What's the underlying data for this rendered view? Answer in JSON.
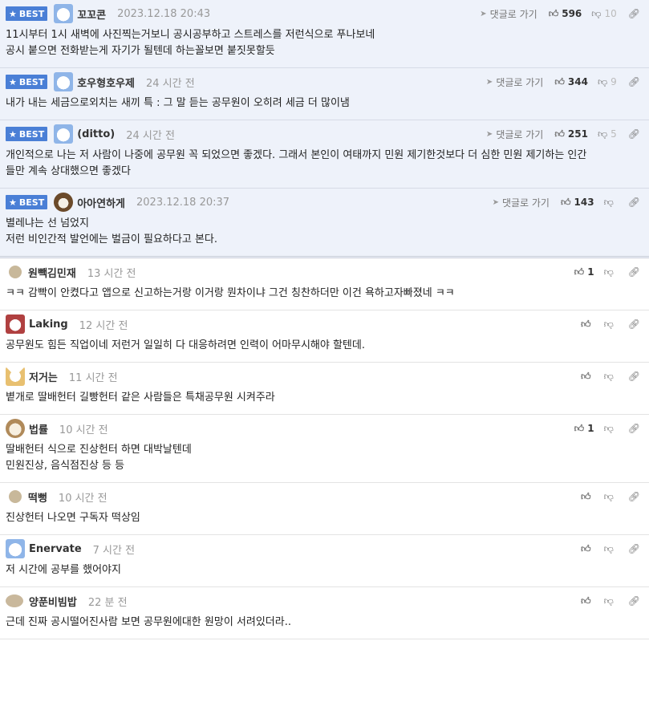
{
  "labels": {
    "best": "BEST",
    "reply": "댓글로 가기"
  },
  "comments": [
    {
      "best": true,
      "avatar": "avatar-blue-face-icon",
      "nick": "꼬꼬콘",
      "time": "2023.12.18 20:43",
      "reply": true,
      "likes": "596",
      "dislikes": "10",
      "lines": [
        "11시부터 1시 새벽에 사진찍는거보니 공시공부하고 스트레스를 저런식으로 푸나보네",
        "공시 붙으면 전화받는게 자기가 될텐데 하는꼴보면 붙짓못할듯"
      ]
    },
    {
      "best": true,
      "avatar": "avatar-blue-face-icon",
      "nick": "호우형호우제",
      "time": "24 시간 전",
      "reply": true,
      "likes": "344",
      "dislikes": "9",
      "lines": [
        "내가 내는 세금으로외치는 새끼 특 : 그 말 듣는 공무원이 오히려 세금 더 많이냄"
      ]
    },
    {
      "best": true,
      "avatar": "avatar-blue-face-icon",
      "nick": "(ditto)",
      "time": "24 시간 전",
      "reply": true,
      "likes": "251",
      "dislikes": "5",
      "lines": [
        "개인적으로 나는 저 사람이 나중에 공무원 꼭 되었으면 좋겠다. 그래서 본인이 여태까지 민원 제기한것보다 더 심한 민원 제기하는 인간",
        "들만 계속 상대했으면 좋겠다"
      ]
    },
    {
      "best": true,
      "avatar": "avatar-bear-icon",
      "nick": "아아연하게",
      "time": "2023.12.18 20:37",
      "reply": true,
      "likes": "143",
      "dislikes": "",
      "lines": [
        "별레냐는 선 넘었지",
        "저런 비인간적 발언에는 벌금이 필요하다고 본다."
      ]
    },
    {
      "best": false,
      "avatar": "avatar-dot-icon",
      "nick": "원빽김민재",
      "time": "13 시간 전",
      "reply": false,
      "likes": "1",
      "dislikes": "",
      "lines": [
        "ㅋㅋ 감빡이 안켰다고 앱으로 신고하는거랑 이거랑 뭔차이냐 그건 칭찬하더만 이건 욕하고자빠졌네 ㅋㅋ"
      ]
    },
    {
      "best": false,
      "avatar": "avatar-red-face-icon",
      "nick": "Laking",
      "time": "12 시간 전",
      "reply": false,
      "likes": "",
      "dislikes": "",
      "lines": [
        "공무원도 힘든 직업이네 저런거 일일히 다 대응하려면 인력이 어마무시해야 할텐데."
      ]
    },
    {
      "best": false,
      "avatar": "avatar-dog-icon",
      "nick": "저거는",
      "time": "11 시간 전",
      "reply": false,
      "likes": "",
      "dislikes": "",
      "lines": [
        "볕개로 딸배헌터 길빵헌터 같은 사람들은 특채공무원 시켜주라"
      ]
    },
    {
      "best": false,
      "avatar": "avatar-puppy-icon",
      "nick": "법률",
      "time": "10 시간 전",
      "reply": false,
      "likes": "1",
      "dislikes": "",
      "lines": [
        "딸배헌터 식으로 진상헌터 하면 대박날텐데",
        "민원진상, 음식점진상 등 등"
      ]
    },
    {
      "best": false,
      "avatar": "avatar-dot-icon",
      "nick": "떡뻥",
      "time": "10 시간 전",
      "reply": false,
      "likes": "",
      "dislikes": "",
      "lines": [
        "진상헌터 나오면 구독자 떡상임"
      ]
    },
    {
      "best": false,
      "avatar": "avatar-blue-face-icon",
      "nick": "Enervate",
      "time": "7 시간 전",
      "reply": false,
      "likes": "",
      "dislikes": "",
      "lines": [
        "저 시간에 공부를 했어야지"
      ]
    },
    {
      "best": false,
      "avatar": "avatar-blob-icon",
      "nick": "양푼비빔밥",
      "time": "22 분 전",
      "reply": false,
      "likes": "",
      "dislikes": "",
      "lines": [
        "근데 진짜 공시떨어진사람 보면 공무원에대한 원망이 서려있더라.."
      ]
    }
  ]
}
